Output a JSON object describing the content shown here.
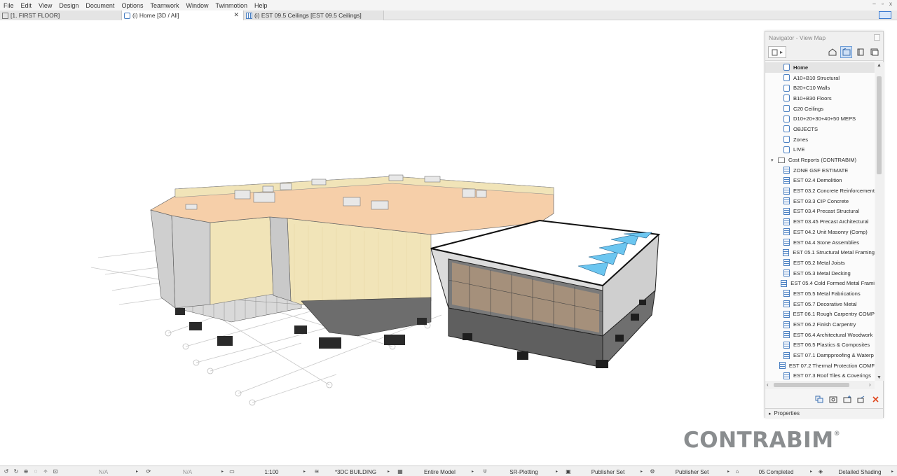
{
  "menu": [
    "File",
    "Edit",
    "View",
    "Design",
    "Document",
    "Options",
    "Teamwork",
    "Window",
    "Twinmotion",
    "Help"
  ],
  "window_controls": "– ▫ x",
  "tabs": [
    {
      "label": "[1. FIRST FLOOR]",
      "icon": "floor-plan-icon",
      "active": false
    },
    {
      "label": "(i) Home [3D / All]",
      "icon": "3d-view-icon",
      "active": true,
      "close": "✕"
    },
    {
      "label": "(i) EST 09.5 Ceilings [EST 09.5 Ceilings]",
      "icon": "schedule-icon",
      "active": false
    }
  ],
  "navigator": {
    "title": "Navigator - View Map",
    "items": [
      {
        "label": "Home",
        "icon": "view",
        "indent": 1,
        "selected": true
      },
      {
        "label": "A10+B10 Structural",
        "icon": "view",
        "indent": 1
      },
      {
        "label": "B20+C10 Walls",
        "icon": "view",
        "indent": 1
      },
      {
        "label": "B10+B30 Floors",
        "icon": "view",
        "indent": 1
      },
      {
        "label": "C20 Ceilings",
        "icon": "view",
        "indent": 1
      },
      {
        "label": "D10+20+30+40+50 MEPS",
        "icon": "view",
        "indent": 1
      },
      {
        "label": "OBJECTS",
        "icon": "view",
        "indent": 1
      },
      {
        "label": "Zones",
        "icon": "view",
        "indent": 1
      },
      {
        "label": "LIVE",
        "icon": "view",
        "indent": 1
      },
      {
        "label": "Cost Reports (CONTRABIM)",
        "icon": "folder",
        "indent": 0,
        "expanded": true
      },
      {
        "label": "ZONE GSF ESTIMATE",
        "icon": "schedule",
        "indent": 1
      },
      {
        "label": "EST 02.4 Demolition",
        "icon": "schedule",
        "indent": 1
      },
      {
        "label": "EST 03.2 Concrete Reinforcement",
        "icon": "schedule",
        "indent": 1
      },
      {
        "label": "EST 03.3 CIP Concrete",
        "icon": "schedule",
        "indent": 1
      },
      {
        "label": "EST 03.4 Precast Structural",
        "icon": "schedule",
        "indent": 1
      },
      {
        "label": "EST 03.45 Precast Architectural",
        "icon": "schedule",
        "indent": 1
      },
      {
        "label": "EST 04.2 Unit Masonry (Comp)",
        "icon": "schedule",
        "indent": 1
      },
      {
        "label": "EST 04.4 Stone Assemblies",
        "icon": "schedule",
        "indent": 1
      },
      {
        "label": "EST 05.1 Structural Metal Framing",
        "icon": "schedule",
        "indent": 1
      },
      {
        "label": "EST 05.2 Metal Joists",
        "icon": "schedule",
        "indent": 1
      },
      {
        "label": "EST 05.3 Metal Decking",
        "icon": "schedule",
        "indent": 1
      },
      {
        "label": "EST 05.4 Cold Formed Metal Frami",
        "icon": "schedule",
        "indent": 1
      },
      {
        "label": "EST 05.5 Metal Fabrications",
        "icon": "schedule",
        "indent": 1
      },
      {
        "label": "EST 05.7 Decorative Metal",
        "icon": "schedule",
        "indent": 1
      },
      {
        "label": "EST 06.1 Rough Carpentry COMP",
        "icon": "schedule",
        "indent": 1
      },
      {
        "label": "EST 06.2 Finish Carpentry",
        "icon": "schedule",
        "indent": 1
      },
      {
        "label": "EST 06.4 Architectural Woodwork",
        "icon": "schedule",
        "indent": 1
      },
      {
        "label": "EST 06.5 Plastics & Composites",
        "icon": "schedule",
        "indent": 1
      },
      {
        "label": "EST 07.1 Dampproofing & Waterp",
        "icon": "schedule",
        "indent": 1
      },
      {
        "label": "EST 07.2 Thermal Protection COMF",
        "icon": "schedule",
        "indent": 1
      },
      {
        "label": "EST 07.3 Roof Tiles & Coverings",
        "icon": "schedule",
        "indent": 1
      }
    ],
    "properties_label": "Properties"
  },
  "logo": {
    "text": "CONTRABIM",
    "mark": "®"
  },
  "statusbar": {
    "field1": "N/A",
    "field2": "N/A",
    "scale": "1:100",
    "layer_combo": "*3DC BUILDING",
    "model_filter": "Entire Model",
    "pen_set": "SR-Plotting",
    "publisher_set_1": "Publisher Set",
    "publisher_set_2": "Publisher Set",
    "renovation": "05 Completed",
    "shading": "Detailed Shading"
  },
  "colors": {
    "accent": "#4a7fc1",
    "roof": "#f6cfa9",
    "facade": "#f1e4b8",
    "glass_blue": "#6cc6f0"
  }
}
